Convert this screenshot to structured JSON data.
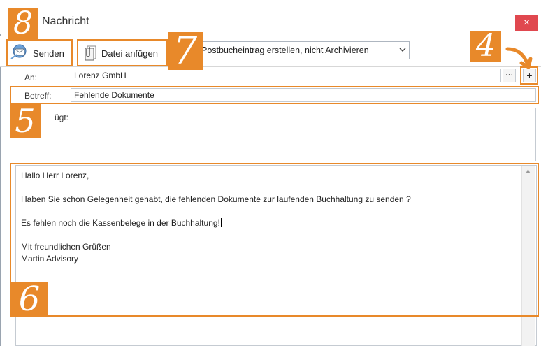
{
  "window": {
    "title": "Nachricht",
    "close_glyph": "×"
  },
  "toolbar": {
    "send_label": "Senden",
    "attach_label": "Datei anfügen",
    "mode_value": "Postbucheintrag erstellen, nicht Archivieren"
  },
  "fields": {
    "to_label": "An:",
    "to_value": "Lorenz GmbH",
    "dots_label": "···",
    "plus_label": "+",
    "subject_label": "Betreff:",
    "subject_value": "Fehlende Dokumente",
    "attached_label": "ügt:"
  },
  "body": {
    "greeting": "Hallo Herr Lorenz,",
    "line1": "Haben Sie schon Gelegenheit gehabt, die fehlenden Dokumente zur laufenden Buchhaltung zu senden ?",
    "line2": "Es fehlen noch die Kassenbelege in der Buchhaltung!",
    "closing": "Mit freundlichen Grüßen",
    "signature": "Martin Advisory"
  },
  "callouts": {
    "n8": "8",
    "n7": "7",
    "n4": "4",
    "n5": "5",
    "n6": "6"
  },
  "icons": [
    "send-icon",
    "attach-icon",
    "chevron-down-icon",
    "close-icon",
    "arrow-icon"
  ],
  "colors": {
    "callout": "#e8892a",
    "close": "#e0484f"
  }
}
